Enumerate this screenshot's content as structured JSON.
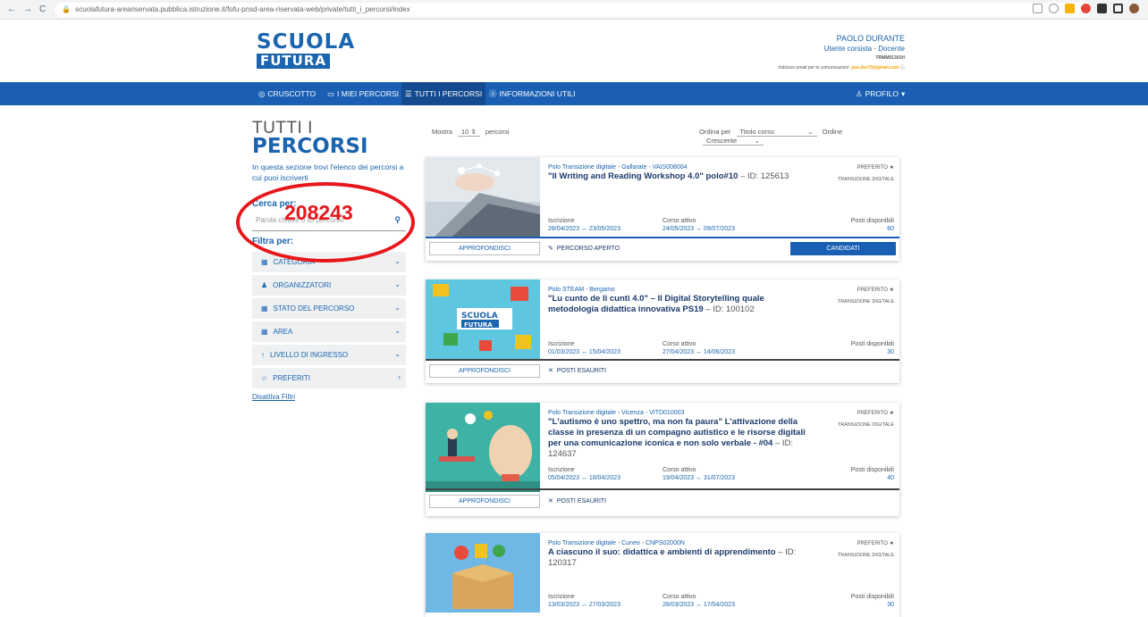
{
  "browser": {
    "url": "scuolafutura-areariservata.pubblica.istruzione.it/fofu-pnsd-area-riservata-web/private/tutti_i_percorsi/index"
  },
  "header": {
    "logo_line1": "SCUOLA",
    "logo_line2": "FUTURA",
    "user_name": "PAOLO DURANTE",
    "user_role": "Utente corsista - Docente",
    "user_code": "TRMM01301H",
    "email_label": "Indirizzo email per le comunicazioni:",
    "email_value": "pao.dur70@gmail.com"
  },
  "nav": {
    "items": [
      {
        "label": "CRUSCOTTO",
        "icon": "dashboard-icon"
      },
      {
        "label": "I MIEI PERCORSI",
        "icon": "monitor-icon"
      },
      {
        "label": "TUTTI I PERCORSI",
        "icon": "list-icon"
      },
      {
        "label": "INFORMAZIONI UTILI",
        "icon": "help-icon"
      }
    ],
    "profile": "PROFILO"
  },
  "sidebar": {
    "title1": "TUTTI I",
    "title2": "PERCORSI",
    "desc": "In questa sezione trovi l'elenco dei percorsi a cui puoi iscriverti",
    "search_label": "Cerca per:",
    "search_placeholder": "Parola chiave o ID percorso",
    "filter_label": "Filtra per:",
    "filters": [
      "CATEGORIA",
      "ORGANIZZATORI",
      "STATO DEL PERCORSO",
      "AREA",
      "LIVELLO DI INGRESSO",
      "PREFERITI"
    ],
    "reset": "Disattiva Filtri"
  },
  "annotation": {
    "number": "208243",
    "color": "#e8161a"
  },
  "toolbar": {
    "show_label": "Mostra",
    "show_value": "10",
    "show_unit": "percorsi",
    "order_by_label": "Ordina per",
    "order_by_value": "Titolo corso",
    "order_label": "Ordine",
    "order_value": "Crescente"
  },
  "cards": [
    {
      "polo": "Polo Transizione digitale - Gallarate - VAIS008004",
      "title": "\"Il Writing and Reading Workshop 4.0\" polo#10",
      "id": " – ID: 125613",
      "preferito": "PREFERITO",
      "tag": "TRANSIZIONE DIGITALE",
      "iscr_label": "Iscrizione",
      "iscr_value": "28/04/2023 ↔ 23/05/2023",
      "corso_label": "Corso attivo",
      "corso_value": "24/05/2023 ↔ 09/07/2023",
      "posti_label": "Posti disponibili",
      "posti_value": "60",
      "appr": "APPROFONDISCI",
      "status": "PERCORSO APERTO",
      "candidati": "CANDIDATI"
    },
    {
      "polo": "Polo STEAM - Bergamo",
      "title": "\"Lu cunto de li cunti 4.0\" – Il Digital Storytelling quale metodologia didattica innovativa PS19",
      "id": " – ID: 100102",
      "preferito": "PREFERITO",
      "tag": "TRANSIZIONE DIGITALE",
      "iscr_label": "Iscrizione",
      "iscr_value": "01/03/2023 ↔ 15/04/2023",
      "corso_label": "Corso attivo",
      "corso_value": "27/04/2023 ↔ 14/06/2023",
      "posti_label": "Posti disponibili",
      "posti_value": "30",
      "appr": "APPROFONDISCI",
      "status": "POSTI ESAURITI"
    },
    {
      "polo": "Polo Transizione digitale - Vicenza - VITD010003",
      "title": "\"L'autismo è uno spettro, ma non fa paura\" L'attivazione della classe in presenza di un compagno autistico e le risorse digitali per una comunicazione iconica e non solo verbale - #04",
      "id": " – ID: 124637",
      "preferito": "PREFERITO",
      "tag": "TRANSIZIONE DIGITALE",
      "iscr_label": "Iscrizione",
      "iscr_value": "05/04/2023 ↔ 18/04/2023",
      "corso_label": "Corso attivo",
      "corso_value": "19/04/2023 ↔ 31/07/2023",
      "posti_label": "Posti disponibili",
      "posti_value": "40",
      "appr": "APPROFONDISCI",
      "status": "POSTI ESAURITI"
    },
    {
      "polo": "Polo Transizione digitale - Cuneo - CNPS02000N",
      "title": "A ciascuno il suo: didattica e ambienti di apprendimento",
      "id": " – ID: 120317",
      "preferito": "PREFERITO",
      "tag": "TRANSIZIONE DIGITALE",
      "iscr_label": "Iscrizione",
      "iscr_value": "13/03/2023 ↔ 27/03/2023",
      "corso_label": "Corso attivo",
      "corso_value": "28/03/2023 ↔ 17/04/2023",
      "posti_label": "Posti disponibili",
      "posti_value": "30"
    }
  ]
}
